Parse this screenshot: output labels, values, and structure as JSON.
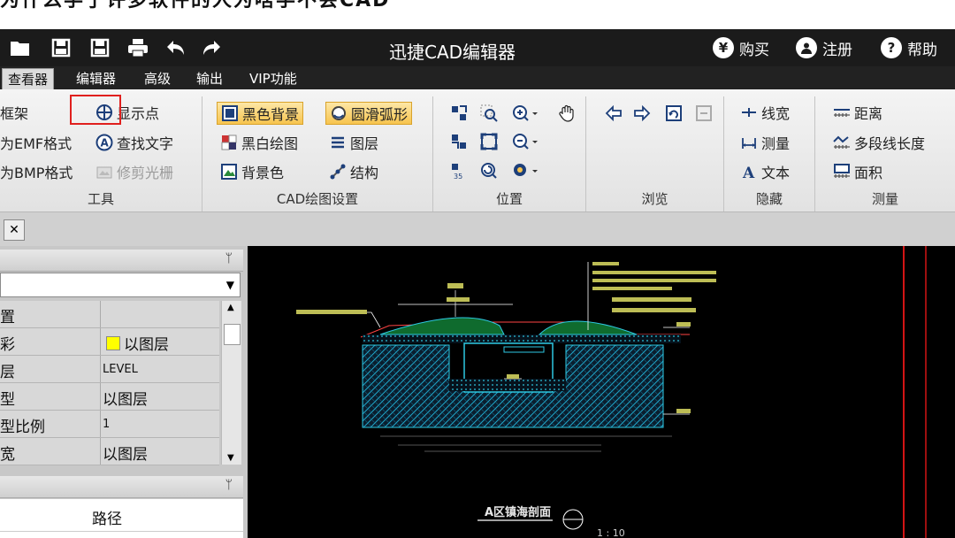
{
  "top_strip": {
    "text": "为什么学了许多软件的人为啥学不会CAD"
  },
  "titlebar": {
    "title": "迅捷CAD编辑器",
    "buy": "购买",
    "register": "注册",
    "help": "帮助",
    "buy_symbol": "¥",
    "help_symbol": "?"
  },
  "menu": {
    "tabs": [
      "查看器",
      "编辑器",
      "高级",
      "输出",
      "VIP功能"
    ]
  },
  "ribbon": {
    "tools": {
      "items": [
        "框架",
        "为EMF格式",
        "为BMP格式",
        "显示点",
        "查找文字",
        "修剪光栅"
      ],
      "label": "工具"
    },
    "cad_settings": {
      "items": [
        "黑色背景",
        "圆滑弧形",
        "黑白绘图",
        "图层",
        "背景色",
        "结构"
      ],
      "label": "CAD绘图设置"
    },
    "position": {
      "label": "位置"
    },
    "browse": {
      "label": "浏览"
    },
    "hide": {
      "items": [
        "线宽",
        "测量",
        "文本"
      ],
      "label": "隐藏"
    },
    "measure": {
      "items": [
        "距离",
        "多段线长度",
        "面积"
      ],
      "label": "测量"
    }
  },
  "left_panel": {
    "pin": "ᛘ",
    "properties": [
      {
        "name": "置",
        "value": ""
      },
      {
        "name": "彩",
        "value": "以图层"
      },
      {
        "name": "层",
        "value": "LEVEL"
      },
      {
        "name": "型",
        "value": "以图层"
      },
      {
        "name": "型比例",
        "value": "1"
      },
      {
        "name": "宽",
        "value": "以图层"
      }
    ],
    "path_header": "路径"
  },
  "canvas": {
    "drawing_title": "A区镇海剖面",
    "scale": "1 : 10"
  },
  "colors": {
    "accent_highlight": "#f7c44e",
    "red_box": "#e0201e",
    "canvas_bg": "#000000"
  }
}
